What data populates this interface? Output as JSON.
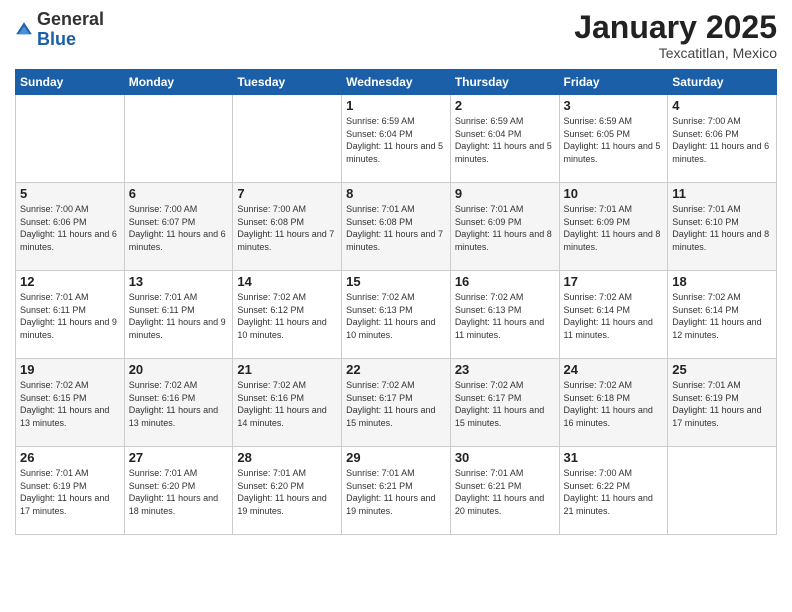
{
  "logo": {
    "general": "General",
    "blue": "Blue"
  },
  "header": {
    "month": "January 2025",
    "location": "Texcatitlan, Mexico"
  },
  "weekdays": [
    "Sunday",
    "Monday",
    "Tuesday",
    "Wednesday",
    "Thursday",
    "Friday",
    "Saturday"
  ],
  "weeks": [
    [
      {
        "day": "",
        "sunrise": "",
        "sunset": "",
        "daylight": ""
      },
      {
        "day": "",
        "sunrise": "",
        "sunset": "",
        "daylight": ""
      },
      {
        "day": "",
        "sunrise": "",
        "sunset": "",
        "daylight": ""
      },
      {
        "day": "1",
        "sunrise": "Sunrise: 6:59 AM",
        "sunset": "Sunset: 6:04 PM",
        "daylight": "Daylight: 11 hours and 5 minutes."
      },
      {
        "day": "2",
        "sunrise": "Sunrise: 6:59 AM",
        "sunset": "Sunset: 6:04 PM",
        "daylight": "Daylight: 11 hours and 5 minutes."
      },
      {
        "day": "3",
        "sunrise": "Sunrise: 6:59 AM",
        "sunset": "Sunset: 6:05 PM",
        "daylight": "Daylight: 11 hours and 5 minutes."
      },
      {
        "day": "4",
        "sunrise": "Sunrise: 7:00 AM",
        "sunset": "Sunset: 6:06 PM",
        "daylight": "Daylight: 11 hours and 6 minutes."
      }
    ],
    [
      {
        "day": "5",
        "sunrise": "Sunrise: 7:00 AM",
        "sunset": "Sunset: 6:06 PM",
        "daylight": "Daylight: 11 hours and 6 minutes."
      },
      {
        "day": "6",
        "sunrise": "Sunrise: 7:00 AM",
        "sunset": "Sunset: 6:07 PM",
        "daylight": "Daylight: 11 hours and 6 minutes."
      },
      {
        "day": "7",
        "sunrise": "Sunrise: 7:00 AM",
        "sunset": "Sunset: 6:08 PM",
        "daylight": "Daylight: 11 hours and 7 minutes."
      },
      {
        "day": "8",
        "sunrise": "Sunrise: 7:01 AM",
        "sunset": "Sunset: 6:08 PM",
        "daylight": "Daylight: 11 hours and 7 minutes."
      },
      {
        "day": "9",
        "sunrise": "Sunrise: 7:01 AM",
        "sunset": "Sunset: 6:09 PM",
        "daylight": "Daylight: 11 hours and 8 minutes."
      },
      {
        "day": "10",
        "sunrise": "Sunrise: 7:01 AM",
        "sunset": "Sunset: 6:09 PM",
        "daylight": "Daylight: 11 hours and 8 minutes."
      },
      {
        "day": "11",
        "sunrise": "Sunrise: 7:01 AM",
        "sunset": "Sunset: 6:10 PM",
        "daylight": "Daylight: 11 hours and 8 minutes."
      }
    ],
    [
      {
        "day": "12",
        "sunrise": "Sunrise: 7:01 AM",
        "sunset": "Sunset: 6:11 PM",
        "daylight": "Daylight: 11 hours and 9 minutes."
      },
      {
        "day": "13",
        "sunrise": "Sunrise: 7:01 AM",
        "sunset": "Sunset: 6:11 PM",
        "daylight": "Daylight: 11 hours and 9 minutes."
      },
      {
        "day": "14",
        "sunrise": "Sunrise: 7:02 AM",
        "sunset": "Sunset: 6:12 PM",
        "daylight": "Daylight: 11 hours and 10 minutes."
      },
      {
        "day": "15",
        "sunrise": "Sunrise: 7:02 AM",
        "sunset": "Sunset: 6:13 PM",
        "daylight": "Daylight: 11 hours and 10 minutes."
      },
      {
        "day": "16",
        "sunrise": "Sunrise: 7:02 AM",
        "sunset": "Sunset: 6:13 PM",
        "daylight": "Daylight: 11 hours and 11 minutes."
      },
      {
        "day": "17",
        "sunrise": "Sunrise: 7:02 AM",
        "sunset": "Sunset: 6:14 PM",
        "daylight": "Daylight: 11 hours and 11 minutes."
      },
      {
        "day": "18",
        "sunrise": "Sunrise: 7:02 AM",
        "sunset": "Sunset: 6:14 PM",
        "daylight": "Daylight: 11 hours and 12 minutes."
      }
    ],
    [
      {
        "day": "19",
        "sunrise": "Sunrise: 7:02 AM",
        "sunset": "Sunset: 6:15 PM",
        "daylight": "Daylight: 11 hours and 13 minutes."
      },
      {
        "day": "20",
        "sunrise": "Sunrise: 7:02 AM",
        "sunset": "Sunset: 6:16 PM",
        "daylight": "Daylight: 11 hours and 13 minutes."
      },
      {
        "day": "21",
        "sunrise": "Sunrise: 7:02 AM",
        "sunset": "Sunset: 6:16 PM",
        "daylight": "Daylight: 11 hours and 14 minutes."
      },
      {
        "day": "22",
        "sunrise": "Sunrise: 7:02 AM",
        "sunset": "Sunset: 6:17 PM",
        "daylight": "Daylight: 11 hours and 15 minutes."
      },
      {
        "day": "23",
        "sunrise": "Sunrise: 7:02 AM",
        "sunset": "Sunset: 6:17 PM",
        "daylight": "Daylight: 11 hours and 15 minutes."
      },
      {
        "day": "24",
        "sunrise": "Sunrise: 7:02 AM",
        "sunset": "Sunset: 6:18 PM",
        "daylight": "Daylight: 11 hours and 16 minutes."
      },
      {
        "day": "25",
        "sunrise": "Sunrise: 7:01 AM",
        "sunset": "Sunset: 6:19 PM",
        "daylight": "Daylight: 11 hours and 17 minutes."
      }
    ],
    [
      {
        "day": "26",
        "sunrise": "Sunrise: 7:01 AM",
        "sunset": "Sunset: 6:19 PM",
        "daylight": "Daylight: 11 hours and 17 minutes."
      },
      {
        "day": "27",
        "sunrise": "Sunrise: 7:01 AM",
        "sunset": "Sunset: 6:20 PM",
        "daylight": "Daylight: 11 hours and 18 minutes."
      },
      {
        "day": "28",
        "sunrise": "Sunrise: 7:01 AM",
        "sunset": "Sunset: 6:20 PM",
        "daylight": "Daylight: 11 hours and 19 minutes."
      },
      {
        "day": "29",
        "sunrise": "Sunrise: 7:01 AM",
        "sunset": "Sunset: 6:21 PM",
        "daylight": "Daylight: 11 hours and 19 minutes."
      },
      {
        "day": "30",
        "sunrise": "Sunrise: 7:01 AM",
        "sunset": "Sunset: 6:21 PM",
        "daylight": "Daylight: 11 hours and 20 minutes."
      },
      {
        "day": "31",
        "sunrise": "Sunrise: 7:00 AM",
        "sunset": "Sunset: 6:22 PM",
        "daylight": "Daylight: 11 hours and 21 minutes."
      },
      {
        "day": "",
        "sunrise": "",
        "sunset": "",
        "daylight": ""
      }
    ]
  ]
}
